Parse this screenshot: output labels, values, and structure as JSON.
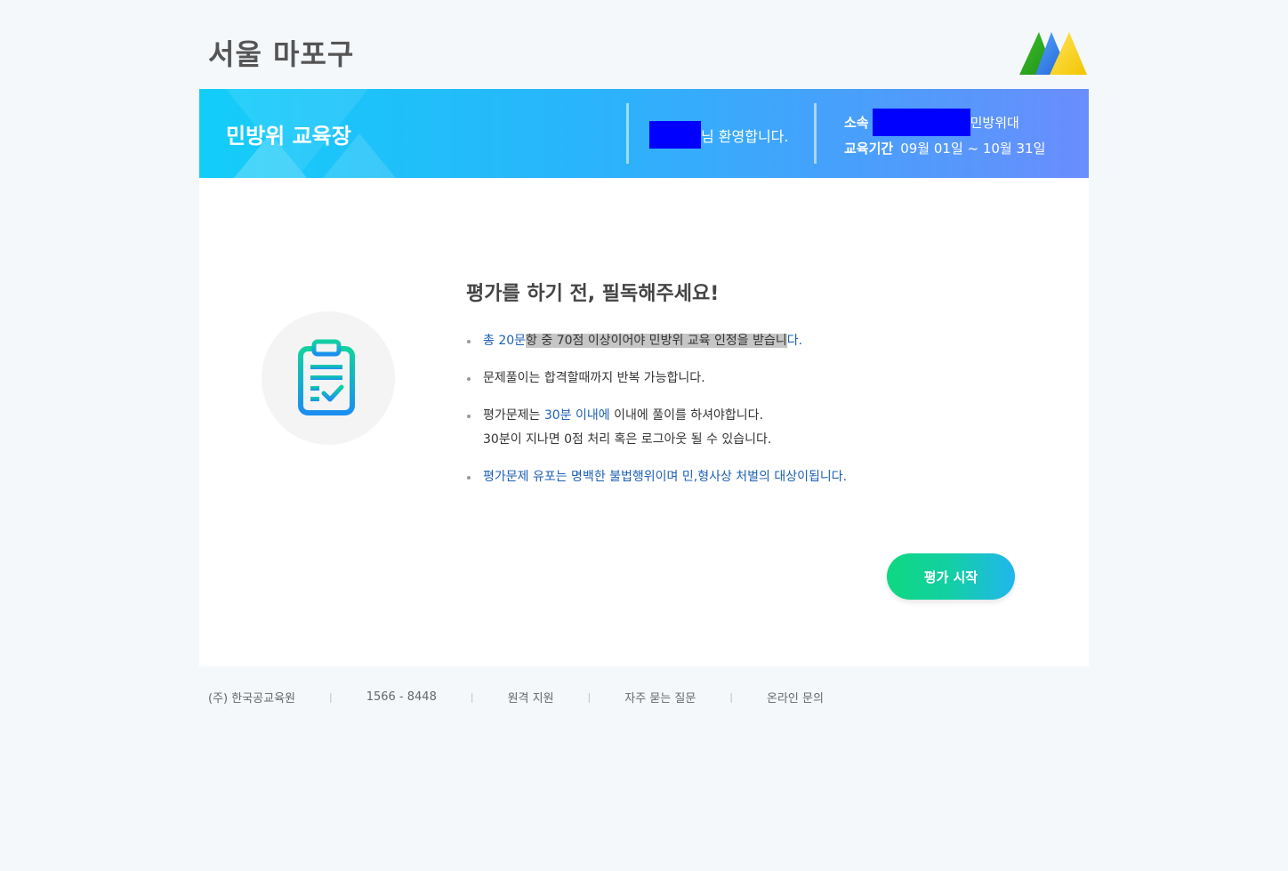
{
  "header": {
    "region_title": "서울 마포구"
  },
  "banner": {
    "title": "민방위 교육장",
    "welcome_suffix": "님 환영합니다.",
    "affiliation_label": "소속",
    "affiliation_suffix": "민방위대",
    "period_label": "교육기간",
    "period_value": "09월 01일 ~ 10월 31일"
  },
  "notice": {
    "title": "평가를 하기 전, 필독해주세요!",
    "item1": {
      "part_blue": "총 20문",
      "part_highlight": "항 중 70점 이상이어야 민방위 교육 인정을 받습니",
      "part_end": "다."
    },
    "item2": "문제풀이는 합격할때까지 반복 가능합니다.",
    "item3": {
      "part_a": "평가문제는 ",
      "part_blue": "30분 이내에",
      "part_b": " 이내에 풀이를 하셔야합니다.",
      "line2": "30분이 지나면 0점 처리 혹은 로그아웃 될 수 있습니다."
    },
    "item4": "평가문제 유포는 명백한 불법행위이며 민,형사상 처벌의 대상이됩니다."
  },
  "actions": {
    "start_label": "평가 시작"
  },
  "footer": {
    "company": "(주) 한국공교육원",
    "phone": "1566 - 8448",
    "remote_support": "원격 지원",
    "faq": "자주 묻는 질문",
    "online_inquiry": "온라인 문의",
    "separator": "|"
  },
  "icons": {
    "logo": "triangle-logo-icon",
    "evaluation": "clipboard-check-icon"
  },
  "colors": {
    "banner_start": "#13cdf9",
    "banner_end": "#6a8dfd",
    "accent_blue": "#1d5fb5",
    "button_start": "#0ed880",
    "button_end": "#21b6ee",
    "redaction": "#0000ff"
  }
}
